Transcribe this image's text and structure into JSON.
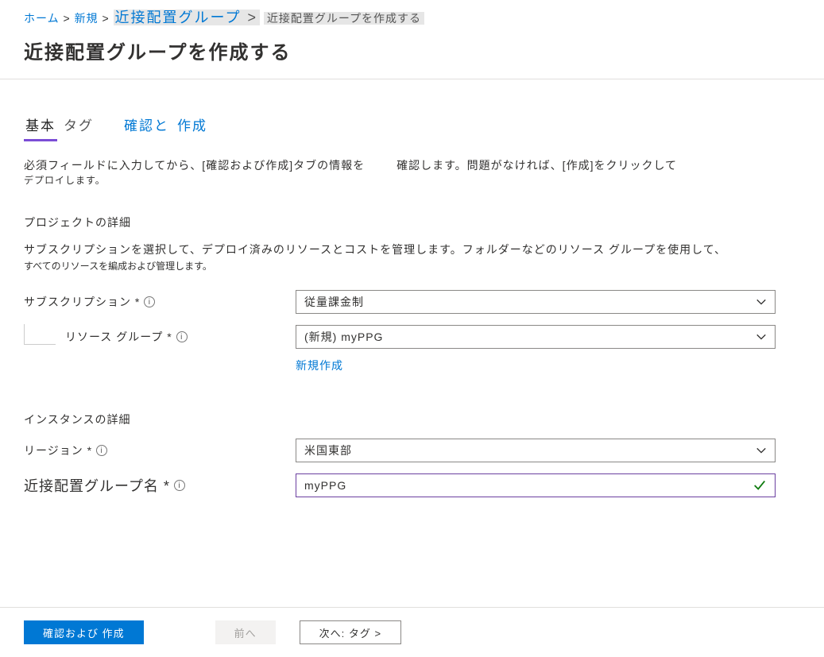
{
  "breadcrumb": {
    "home": "ホーム",
    "new": "新規",
    "ppg": "近接配置グループ",
    "create": "近接配置グループを作成する"
  },
  "page_title": "近接配置グループを作成する",
  "tabs": {
    "basics": "基本",
    "tags": "タグ",
    "review_part1": "確認と",
    "review_part2": "作成"
  },
  "description": {
    "line1_left": "必須フィールドに入力してから、[確認および作成]タブの情報を",
    "line1_right": "確認します。問題がなければ、[作成]をクリックして",
    "line2": "デプロイします。"
  },
  "project": {
    "header": "プロジェクトの詳細",
    "desc1": "サブスクリプションを選択して、デプロイ済みのリソースとコストを管理します。フォルダーなどのリソース グループを使用して、",
    "desc2": "すべてのリソースを編成および管理します。",
    "subscription_label": "サブスクリプション *",
    "subscription_value": "従量課金制",
    "resource_group_label": "リソース グループ *",
    "resource_group_value": "(新規) myPPG",
    "create_new": "新規作成"
  },
  "instance": {
    "header": "インスタンスの詳細",
    "region_label": "リージョン *",
    "region_value": "米国東部",
    "ppg_name_label": "近接配置グループ名 *",
    "ppg_name_value": "myPPG"
  },
  "footer": {
    "review_create": "確認および 作成",
    "previous": "前へ",
    "next": "次へ: タグ >"
  }
}
